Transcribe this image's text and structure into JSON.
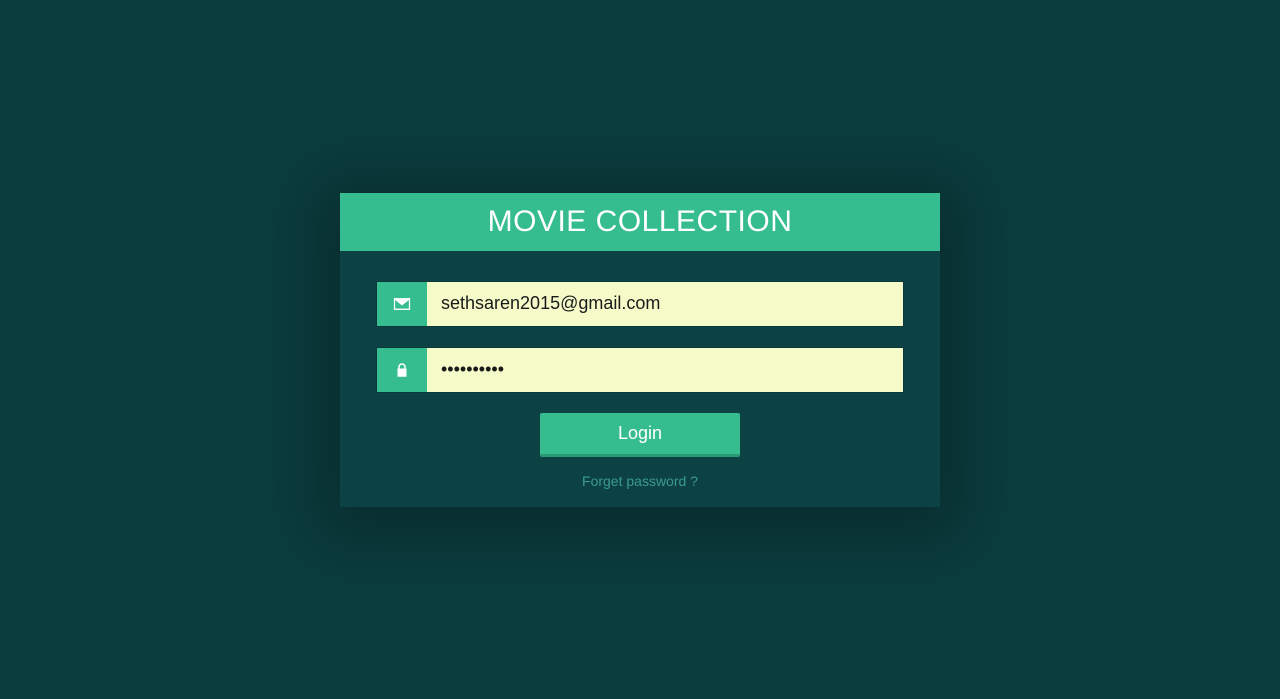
{
  "header": {
    "title": "MOVIE COLLECTION"
  },
  "form": {
    "email_value": "sethsaren2015@gmail.com",
    "password_value": "••••••••••",
    "login_label": "Login",
    "forget_label": "Forget password ?"
  }
}
